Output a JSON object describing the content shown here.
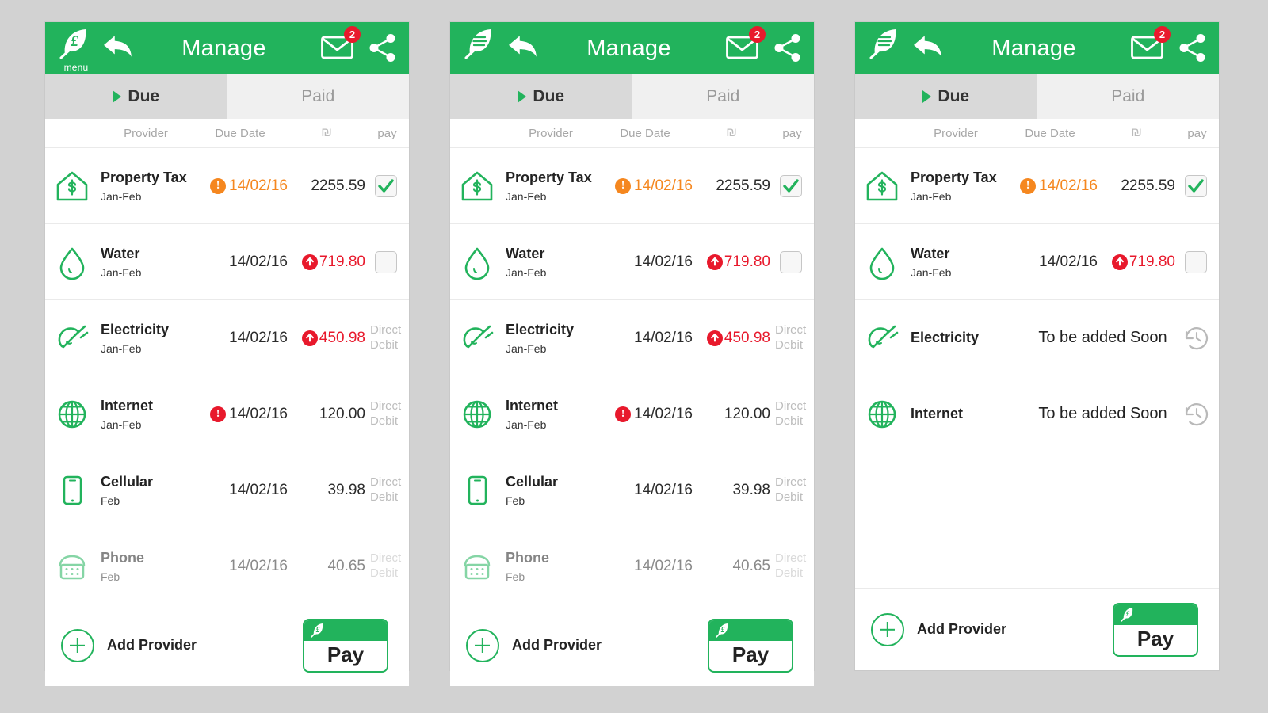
{
  "theme": {
    "brand_green": "#22b35c",
    "alert_red": "#e8192c",
    "alert_orange": "#f5871f",
    "page_background": "#d2d2d2",
    "tab_active_bg": "#d9d9d9",
    "tab_inactive_bg": "#f0f0f0"
  },
  "header": {
    "title": "Manage",
    "menu_label": "menu",
    "logo_icon": "leaf-logo-icon",
    "back_icon": "back-arrow-icon",
    "mail_icon": "mail-icon",
    "mail_badge": "2",
    "share_icon": "share-icon"
  },
  "tabs": {
    "due": "Due",
    "paid": "Paid",
    "marker_icon": "triangle-marker-icon"
  },
  "columns": {
    "provider": "Provider",
    "due_date": "Due Date",
    "amount": "₪",
    "pay": "pay"
  },
  "footer": {
    "add_provider": "Add Provider",
    "add_icon": "plus-circle-icon",
    "pay_label": "Pay",
    "pay_card_icon": "leaf-card-icon"
  },
  "labels": {
    "direct_debit_line1": "Direct",
    "direct_debit_line2": "Debit",
    "to_be_added_soon": "To be added Soon",
    "clock_icon": "history-clock-icon"
  },
  "panels": [
    {
      "id": "panel-1",
      "logo_variant": "leaf-with-menu-word",
      "rows": [
        {
          "icon": "house-dollar-icon",
          "provider": "Property Tax",
          "period": "Jan-Feb",
          "date": "14/02/16",
          "date_alert": "orange",
          "date_color": "orange",
          "amount": "2255.59",
          "amount_alert": "none",
          "amount_color": "dark",
          "pay_type": "checkbox",
          "checked": true,
          "faded": false
        },
        {
          "icon": "water-drop-icon",
          "provider": "Water",
          "period": "Jan-Feb",
          "date": "14/02/16",
          "date_alert": "none",
          "date_color": "dark",
          "amount": "719.80",
          "amount_alert": "up-red",
          "amount_color": "red",
          "pay_type": "checkbox",
          "checked": false,
          "faded": false
        },
        {
          "icon": "plug-icon",
          "provider": "Electricity",
          "period": "Jan-Feb",
          "date": "14/02/16",
          "date_alert": "none",
          "date_color": "dark",
          "amount": "450.98",
          "amount_alert": "up-red",
          "amount_color": "red",
          "pay_type": "direct-debit",
          "checked": false,
          "faded": false
        },
        {
          "icon": "globe-icon",
          "provider": "Internet",
          "period": "Jan-Feb",
          "date": "14/02/16",
          "date_alert": "red",
          "date_color": "dark",
          "amount": "120.00",
          "amount_alert": "none",
          "amount_color": "dark",
          "pay_type": "direct-debit",
          "checked": false,
          "faded": false
        },
        {
          "icon": "smartphone-icon",
          "provider": "Cellular",
          "period": "Feb",
          "date": "14/02/16",
          "date_alert": "none",
          "date_color": "dark",
          "amount": "39.98",
          "amount_alert": "none",
          "amount_color": "dark",
          "pay_type": "direct-debit",
          "checked": false,
          "faded": false
        },
        {
          "icon": "telephone-icon",
          "provider": "Phone",
          "period": "Feb",
          "date": "14/02/16",
          "date_alert": "none",
          "date_color": "dark",
          "amount": "40.65",
          "amount_alert": "none",
          "amount_color": "dark",
          "pay_type": "direct-debit",
          "checked": false,
          "faded": true
        }
      ]
    },
    {
      "id": "panel-2",
      "logo_variant": "leaf-lines",
      "rows": [
        {
          "icon": "house-dollar-icon",
          "provider": "Property Tax",
          "period": "Jan-Feb",
          "date": "14/02/16",
          "date_alert": "orange",
          "date_color": "orange",
          "amount": "2255.59",
          "amount_alert": "none",
          "amount_color": "dark",
          "pay_type": "checkbox",
          "checked": true,
          "faded": false
        },
        {
          "icon": "water-drop-icon",
          "provider": "Water",
          "period": "Jan-Feb",
          "date": "14/02/16",
          "date_alert": "none",
          "date_color": "dark",
          "amount": "719.80",
          "amount_alert": "up-red",
          "amount_color": "red",
          "pay_type": "checkbox",
          "checked": false,
          "faded": false
        },
        {
          "icon": "plug-icon",
          "provider": "Electricity",
          "period": "Jan-Feb",
          "date": "14/02/16",
          "date_alert": "none",
          "date_color": "dark",
          "amount": "450.98",
          "amount_alert": "up-red",
          "amount_color": "red",
          "pay_type": "direct-debit",
          "checked": false,
          "faded": false
        },
        {
          "icon": "globe-icon",
          "provider": "Internet",
          "period": "Jan-Feb",
          "date": "14/02/16",
          "date_alert": "red",
          "date_color": "dark",
          "amount": "120.00",
          "amount_alert": "none",
          "amount_color": "dark",
          "pay_type": "direct-debit",
          "checked": false,
          "faded": false
        },
        {
          "icon": "smartphone-icon",
          "provider": "Cellular",
          "period": "Feb",
          "date": "14/02/16",
          "date_alert": "none",
          "date_color": "dark",
          "amount": "39.98",
          "amount_alert": "none",
          "amount_color": "dark",
          "pay_type": "direct-debit",
          "checked": false,
          "faded": false
        },
        {
          "icon": "telephone-icon",
          "provider": "Phone",
          "period": "Feb",
          "date": "14/02/16",
          "date_alert": "none",
          "date_color": "dark",
          "amount": "40.65",
          "amount_alert": "none",
          "amount_color": "dark",
          "pay_type": "direct-debit",
          "checked": false,
          "faded": true
        }
      ]
    },
    {
      "id": "panel-3",
      "logo_variant": "leaf-lines",
      "rows": [
        {
          "icon": "house-dollar-icon",
          "provider": "Property Tax",
          "period": "Jan-Feb",
          "date": "14/02/16",
          "date_alert": "orange",
          "date_color": "orange",
          "amount": "2255.59",
          "amount_alert": "none",
          "amount_color": "dark",
          "pay_type": "checkbox",
          "checked": true,
          "faded": false
        },
        {
          "icon": "water-drop-icon",
          "provider": "Water",
          "period": "Jan-Feb",
          "date": "14/02/16",
          "date_alert": "none",
          "date_color": "dark",
          "amount": "719.80",
          "amount_alert": "up-red",
          "amount_color": "red",
          "pay_type": "checkbox",
          "checked": false,
          "faded": false
        },
        {
          "icon": "plug-icon",
          "provider": "Electricity",
          "period": "",
          "soon_text": "To be added Soon",
          "pay_type": "soon",
          "faded": false
        },
        {
          "icon": "globe-icon",
          "provider": "Internet",
          "period": "",
          "soon_text": "To be added Soon",
          "pay_type": "soon",
          "faded": false
        }
      ]
    }
  ]
}
